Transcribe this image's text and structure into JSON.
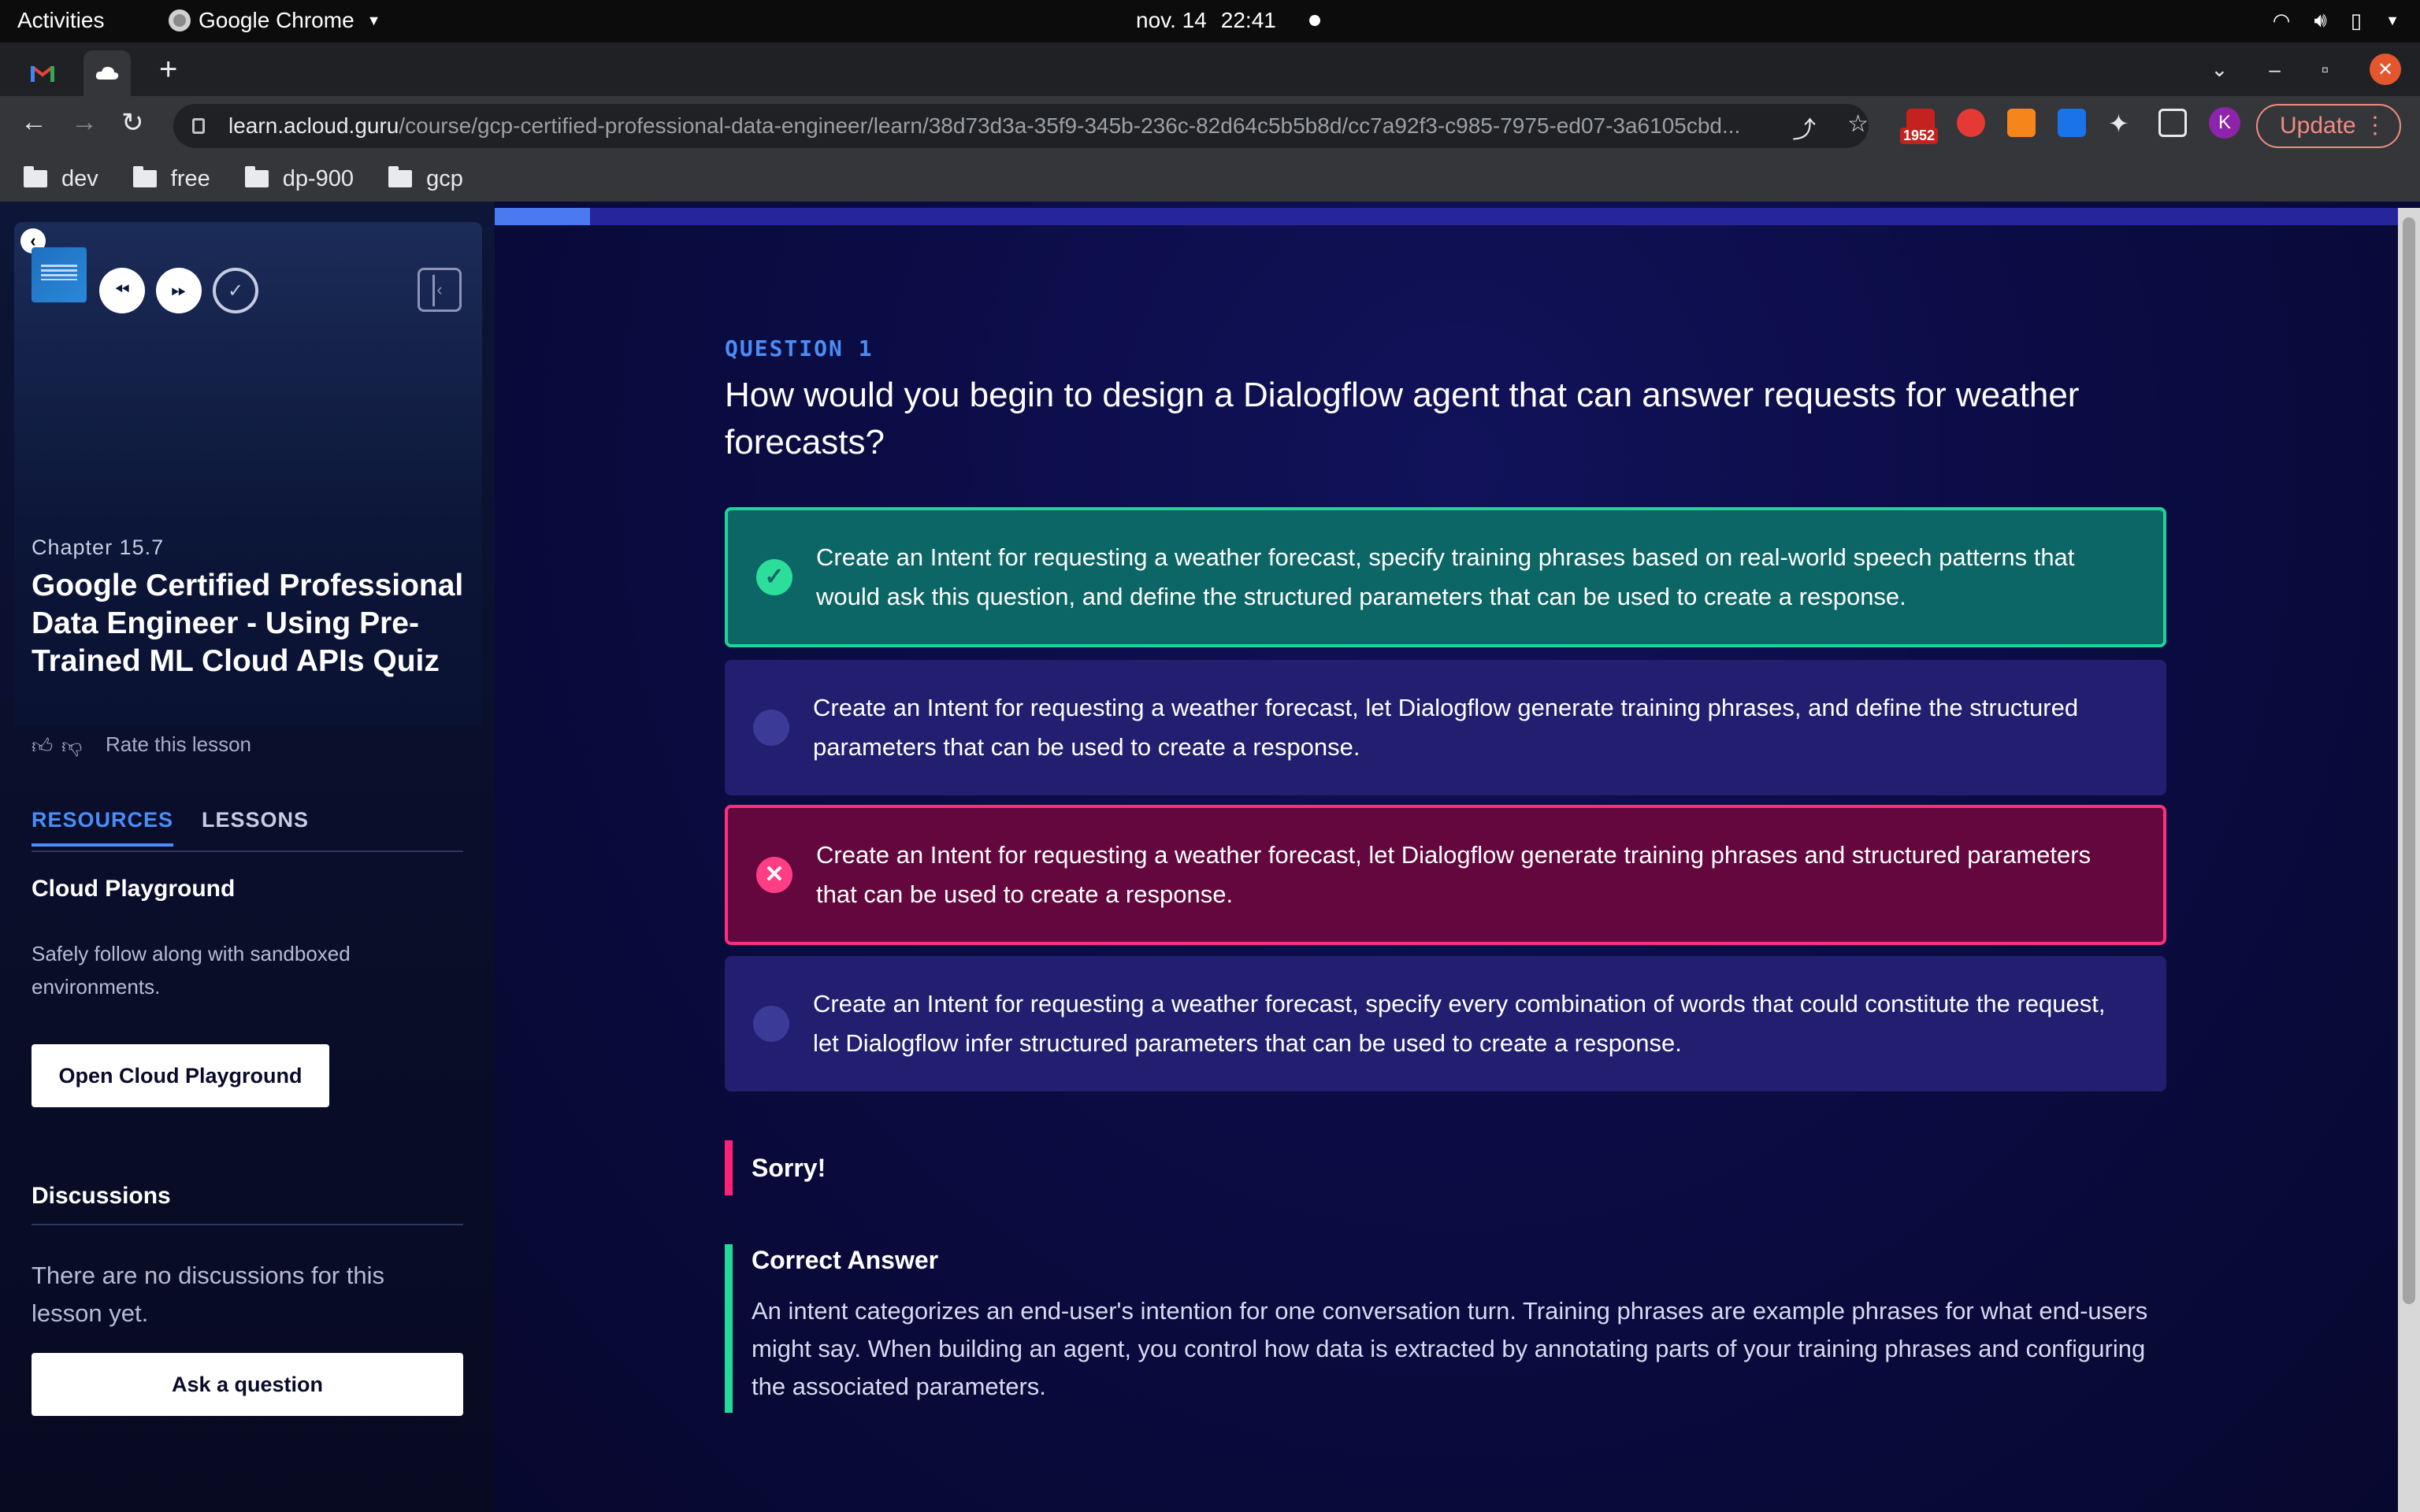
{
  "gnome": {
    "activities": "Activities",
    "app_name": "Google Chrome",
    "date": "nov. 14",
    "time": "22:41"
  },
  "browser": {
    "url_host": "learn.acloud.guru",
    "url_path": "/course/gcp-certified-professional-data-engineer/learn/38d73d3a-35f9-345b-236c-82d64c5b5b8d/cc7a92f3-c985-7975-ed07-3a6105cbd...",
    "extension_badge": "1952",
    "profile_initial": "K",
    "update_label": "Update",
    "bookmarks": [
      "dev",
      "free",
      "dp-900",
      "gcp"
    ]
  },
  "sidebar": {
    "chapter": "Chapter 15.7",
    "title": "Google Certified Professional Data Engineer - Using Pre-Trained ML Cloud APIs Quiz",
    "rate_label": "Rate this lesson",
    "tabs": {
      "resources": "RESOURCES",
      "lessons": "LESSONS"
    },
    "playground_title": "Cloud Playground",
    "playground_desc": "Safely follow along with sandboxed environments.",
    "playground_button": "Open Cloud Playground",
    "discussions_title": "Discussions",
    "no_discussions": "There are no discussions for this lesson yet.",
    "ask_button": "Ask a question"
  },
  "quiz": {
    "progress_fraction": 0.05,
    "question_label": "QUESTION 1",
    "question": "How would you begin to design a Dialogflow agent that can answer requests for weather forecasts?",
    "answers": [
      {
        "text": "Create an Intent for requesting a weather forecast, specify training phrases based on real-world speech patterns that would ask this question, and define the structured parameters that can be used to create a response.",
        "state": "correct"
      },
      {
        "text": "Create an Intent for requesting a weather forecast, let Dialogflow generate training phrases, and define the structured parameters that can be used to create a response.",
        "state": "neutral"
      },
      {
        "text": "Create an Intent for requesting a weather forecast, let Dialogflow generate training phrases and structured parameters that can be used to create a response.",
        "state": "incorrect"
      },
      {
        "text": "Create an Intent for requesting a weather forecast, specify every combination of words that could constitute the request, let Dialogflow infer structured parameters that can be used to create a response.",
        "state": "neutral"
      }
    ],
    "result_label": "Sorry!",
    "correct_title": "Correct Answer",
    "correct_text": "An intent categorizes an end-user's intention for one conversation turn. Training phrases are example phrases for what end-users might say. When building an agent, you control how data is extracted by annotating parts of your training phrases and configuring the associated parameters."
  },
  "colors": {
    "accent_blue": "#4b8df8",
    "correct_green": "#1ed39a",
    "incorrect_pink": "#ff2f7c"
  }
}
